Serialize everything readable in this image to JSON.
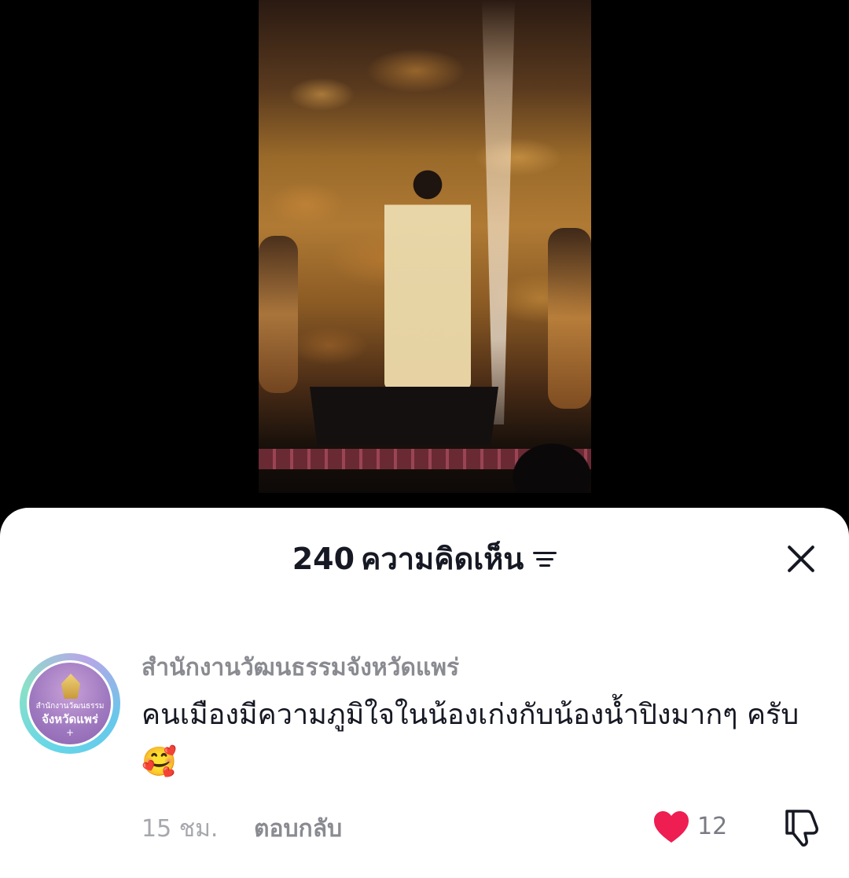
{
  "video": {
    "description_icon": "concert-video"
  },
  "comments_sheet": {
    "count": "240",
    "title_suffix": "ความคิดเห็น",
    "sort_icon": "sort-icon",
    "close_icon": "close-icon"
  },
  "comment": {
    "avatar": {
      "small_text": "สำนักงานวัฒนธรรม",
      "big_text": "จังหวัดแพร่",
      "plus_text": "+"
    },
    "username": "สำนักงานวัฒนธรรมจังหวัดแพร่",
    "text": "คนเมืองมีความภูมิใจในน้องเก่งกับน้องน้ำปิงมากๆ ครับ🥰",
    "timestamp": "15 ชม.",
    "reply_label": "ตอบกลับ",
    "like_count": "12",
    "liked": true,
    "colors": {
      "heart": "#ee1d52",
      "text_primary": "#161823",
      "text_secondary": "#8a8b91"
    }
  }
}
